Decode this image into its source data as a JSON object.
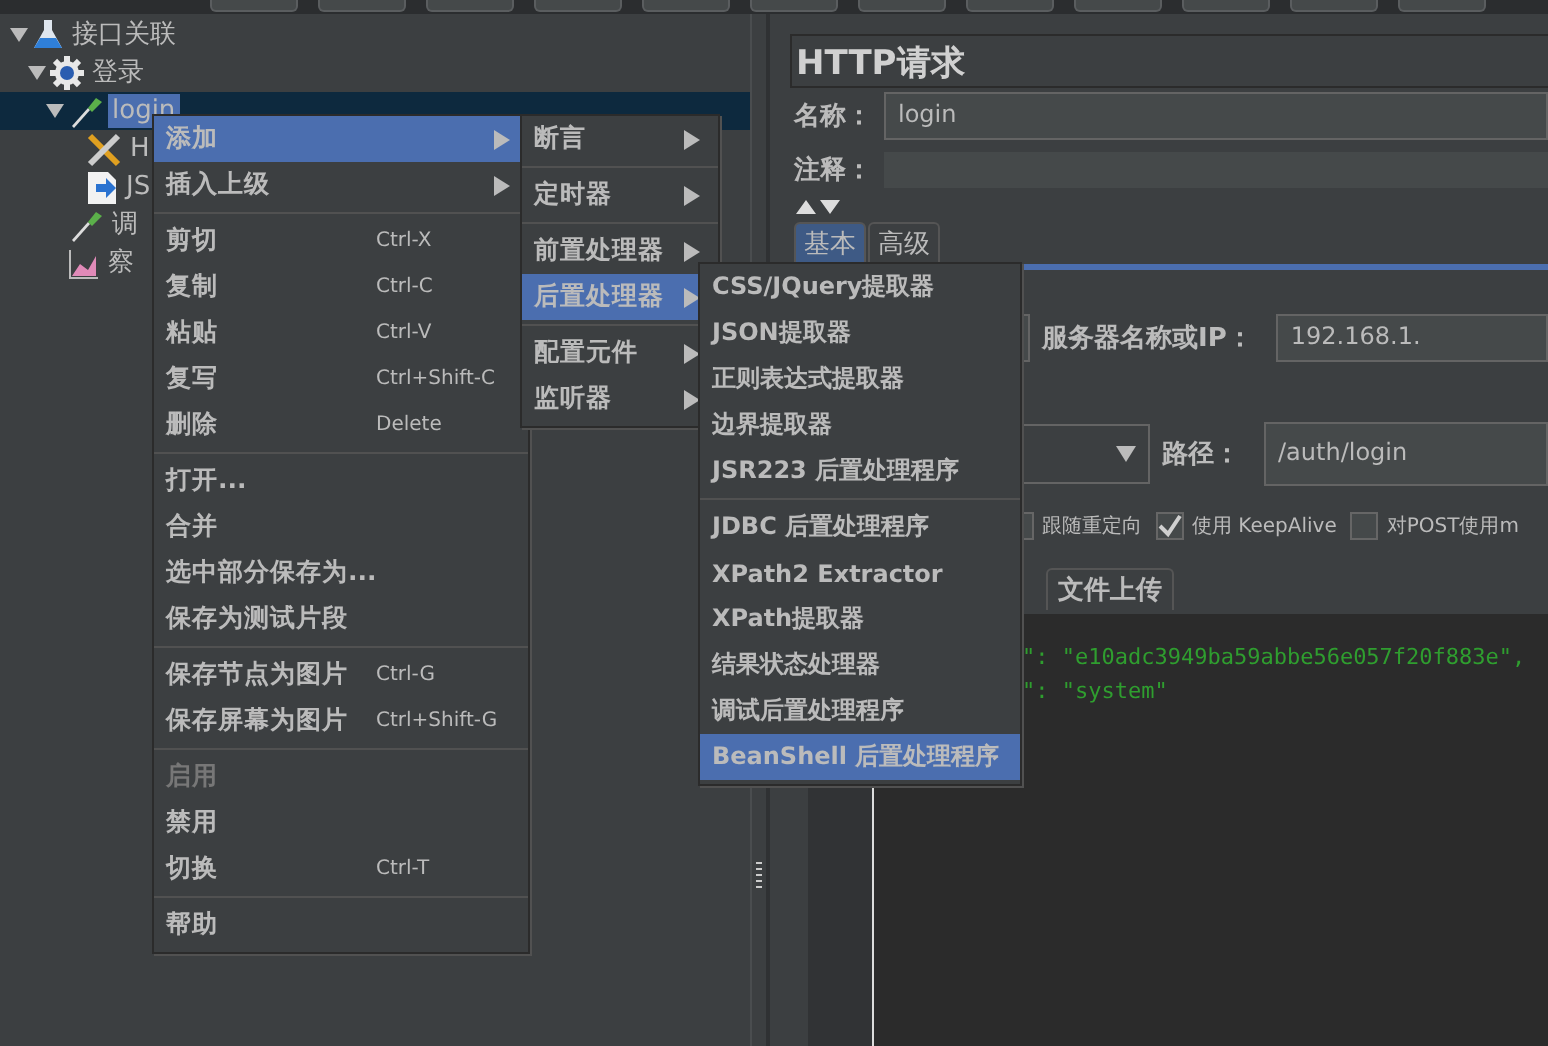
{
  "tree": [
    {
      "label": "接口关联",
      "kind": "plan",
      "expanded": true,
      "selected": false,
      "children": [
        {
          "label": "登录",
          "kind": "thread-group",
          "expanded": true,
          "selected": false,
          "children": [
            {
              "label": "login",
              "kind": "sampler",
              "expanded": true,
              "selected": true,
              "children": [
                {
                  "label": "H",
                  "kind": "manager",
                  "selected": false
                },
                {
                  "label": "JS",
                  "kind": "extractor",
                  "selected": false
                }
              ]
            },
            {
              "label": "调",
              "kind": "sampler",
              "selected": false
            },
            {
              "label": "察",
              "kind": "listener",
              "selected": false
            }
          ]
        }
      ]
    }
  ],
  "editor": {
    "title": "HTTP请求",
    "name_label": "名称：",
    "name_value": "login",
    "comment_label": "注释：",
    "tabs": [
      {
        "label": "基本",
        "selected": true
      },
      {
        "label": "高级",
        "selected": false
      }
    ],
    "server_label": "服务器名称或IP：",
    "server_value": "192.168.1.",
    "path_label": "路径：",
    "path_value": "/auth/login",
    "options": [
      {
        "label": "跟随重定向",
        "checked": false
      },
      {
        "label": "使用 KeepAlive",
        "checked": true
      },
      {
        "label": "对POST使用m",
        "checked": false
      }
    ],
    "body_tabs": [
      {
        "label": "文件上传",
        "selected": false
      }
    ],
    "body_lines": [
      "\": \"e10adc3949ba59abbe56e057f20f883e\",",
      "\": \"system\""
    ]
  },
  "context_menu": {
    "groups": [
      [
        {
          "label": "添加",
          "submenu": true,
          "selected": true,
          "disabled": false
        },
        {
          "label": "插入上级",
          "submenu": true,
          "selected": false,
          "disabled": false
        }
      ],
      [
        {
          "label": "剪切",
          "shortcut": "Ctrl-X",
          "selected": false,
          "disabled": false
        },
        {
          "label": "复制",
          "shortcut": "Ctrl-C",
          "selected": false,
          "disabled": false
        },
        {
          "label": "粘贴",
          "shortcut": "Ctrl-V",
          "selected": false,
          "disabled": false
        },
        {
          "label": "复写",
          "shortcut": "Ctrl+Shift-C",
          "selected": false,
          "disabled": false
        },
        {
          "label": "删除",
          "shortcut": "Delete",
          "selected": false,
          "disabled": false
        }
      ],
      [
        {
          "label": "打开...",
          "selected": false,
          "disabled": false
        },
        {
          "label": "合并",
          "selected": false,
          "disabled": false
        },
        {
          "label": "选中部分保存为...",
          "selected": false,
          "disabled": false
        },
        {
          "label": "保存为测试片段",
          "selected": false,
          "disabled": false
        }
      ],
      [
        {
          "label": "保存节点为图片",
          "shortcut": "Ctrl-G",
          "selected": false,
          "disabled": false
        },
        {
          "label": "保存屏幕为图片",
          "shortcut": "Ctrl+Shift-G",
          "selected": false,
          "disabled": false
        }
      ],
      [
        {
          "label": "启用",
          "selected": false,
          "disabled": true
        },
        {
          "label": "禁用",
          "selected": false,
          "disabled": false
        },
        {
          "label": "切换",
          "shortcut": "Ctrl-T",
          "selected": false,
          "disabled": false
        }
      ],
      [
        {
          "label": "帮助",
          "selected": false,
          "disabled": false
        }
      ]
    ]
  },
  "add_submenu": {
    "groups": [
      [
        {
          "label": "断言",
          "submenu": true,
          "selected": false
        }
      ],
      [
        {
          "label": "定时器",
          "submenu": true,
          "selected": false
        }
      ],
      [
        {
          "label": "前置处理器",
          "submenu": true,
          "selected": false
        },
        {
          "label": "后置处理器",
          "submenu": true,
          "selected": true
        }
      ],
      [
        {
          "label": "配置元件",
          "submenu": true,
          "selected": false
        },
        {
          "label": "监听器",
          "submenu": true,
          "selected": false
        }
      ]
    ]
  },
  "post_processor_submenu": {
    "groups": [
      [
        {
          "label": "CSS/JQuery提取器",
          "selected": false
        },
        {
          "label": "JSON提取器",
          "selected": false
        },
        {
          "label": "正则表达式提取器",
          "selected": false
        },
        {
          "label": "边界提取器",
          "selected": false
        },
        {
          "label": "JSR223 后置处理程序",
          "selected": false
        }
      ],
      [
        {
          "label": "JDBC 后置处理程序",
          "selected": false
        },
        {
          "label": "XPath2 Extractor",
          "selected": false
        },
        {
          "label": "XPath提取器",
          "selected": false
        },
        {
          "label": "结果状态处理器",
          "selected": false
        },
        {
          "label": "调试后置处理程序",
          "selected": false
        },
        {
          "label": "BeanShell 后置处理程序",
          "selected": true
        }
      ]
    ]
  }
}
